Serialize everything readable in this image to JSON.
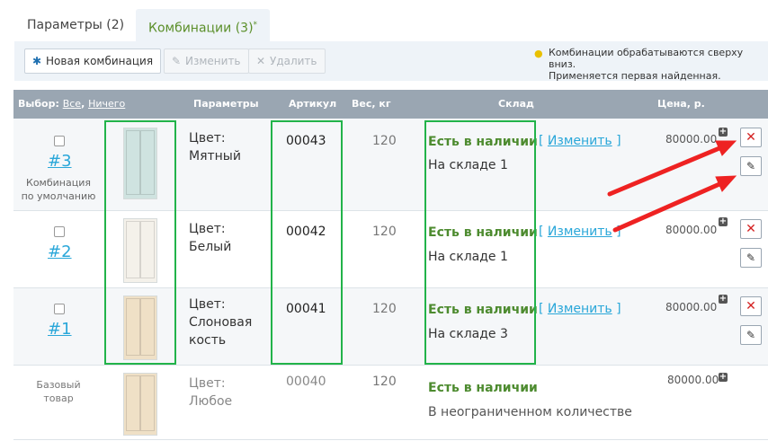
{
  "tabs": [
    {
      "label": "Параметры (2)"
    },
    {
      "label": "Комбинации (3)",
      "marker": "*"
    }
  ],
  "toolbar": {
    "new_label": "Новая комбинация",
    "edit_label": "Изменить",
    "delete_label": "Удалить",
    "hint_line1": "Комбинации обрабатываются сверху вниз.",
    "hint_line2": "Применяется первая найденная."
  },
  "table": {
    "headers": {
      "select": "Выбор:",
      "all": "Все",
      "none": "Ничего",
      "params": "Параметры",
      "article": "Артикул",
      "weight": "Вес, кг",
      "stock": "Склад",
      "price": "Цена, р."
    },
    "rows": [
      {
        "num": "#3",
        "note_1": "Комбинация",
        "note_2": "по умолчанию",
        "param_1": "Цвет:",
        "param_2": "Мятный",
        "param_3": "",
        "article": "00043",
        "weight": "120",
        "stock_status": "Есть в наличии",
        "warehouse": "На складе 1",
        "change_label": "Изменить",
        "price": "80000.00",
        "color": "#cfe3e0"
      },
      {
        "num": "#2",
        "param_1": "Цвет:",
        "param_2": "Белый",
        "param_3": "",
        "article": "00042",
        "weight": "120",
        "stock_status": "Есть в наличии",
        "warehouse": "На складе 1",
        "change_label": "Изменить",
        "price": "80000.00",
        "color": "#f4f1ea"
      },
      {
        "num": "#1",
        "param_1": "Цвет:",
        "param_2": "Слоновая",
        "param_3": "кость",
        "article": "00041",
        "weight": "120",
        "stock_status": "Есть в наличии",
        "warehouse": "На складе 3",
        "change_label": "Изменить",
        "price": "80000.00",
        "color": "#efe0c6"
      }
    ],
    "base": {
      "label_1": "Базовый",
      "label_2": "товар",
      "param_1": "Цвет:",
      "param_2": "Любое",
      "article": "00040",
      "weight": "120",
      "stock_status": "Есть в наличии",
      "warehouse": "В неограниченном количестве",
      "price": "80000.00",
      "color": "#efe0c6"
    }
  },
  "icons": {
    "hint": "lightbulb-icon",
    "new": "asterisk-icon",
    "edit": "pencil-icon",
    "delete": "x-icon",
    "add_price": "plus-icon"
  },
  "colors": {
    "accent": "#2aa7d9",
    "stock_green": "#4d8b2f",
    "header_bg": "#9aa6b2",
    "highlight": "#22b34a",
    "arrow": "#ee2222"
  }
}
